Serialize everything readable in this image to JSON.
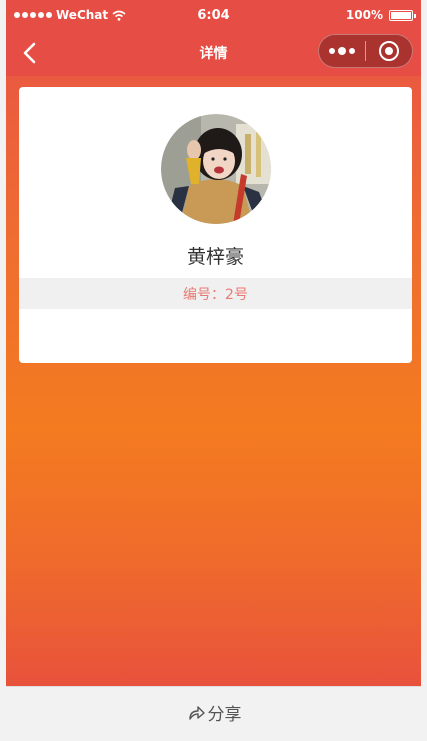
{
  "status_bar": {
    "carrier": "WeChat",
    "time": "6:04",
    "battery": "100%"
  },
  "nav": {
    "title": "详情"
  },
  "profile": {
    "name": "黄梓豪",
    "id_label": "编号：2号"
  },
  "share": {
    "label": "分享"
  },
  "colors": {
    "header": "#e64d45",
    "gradient_mid": "#f47b20",
    "id_text": "#e77a74"
  },
  "icons": [
    "back-chevron-icon",
    "more-dots-icon",
    "close-ring-icon",
    "share-arrow-icon",
    "wifi-icon",
    "battery-icon",
    "signal-dots-icon"
  ]
}
